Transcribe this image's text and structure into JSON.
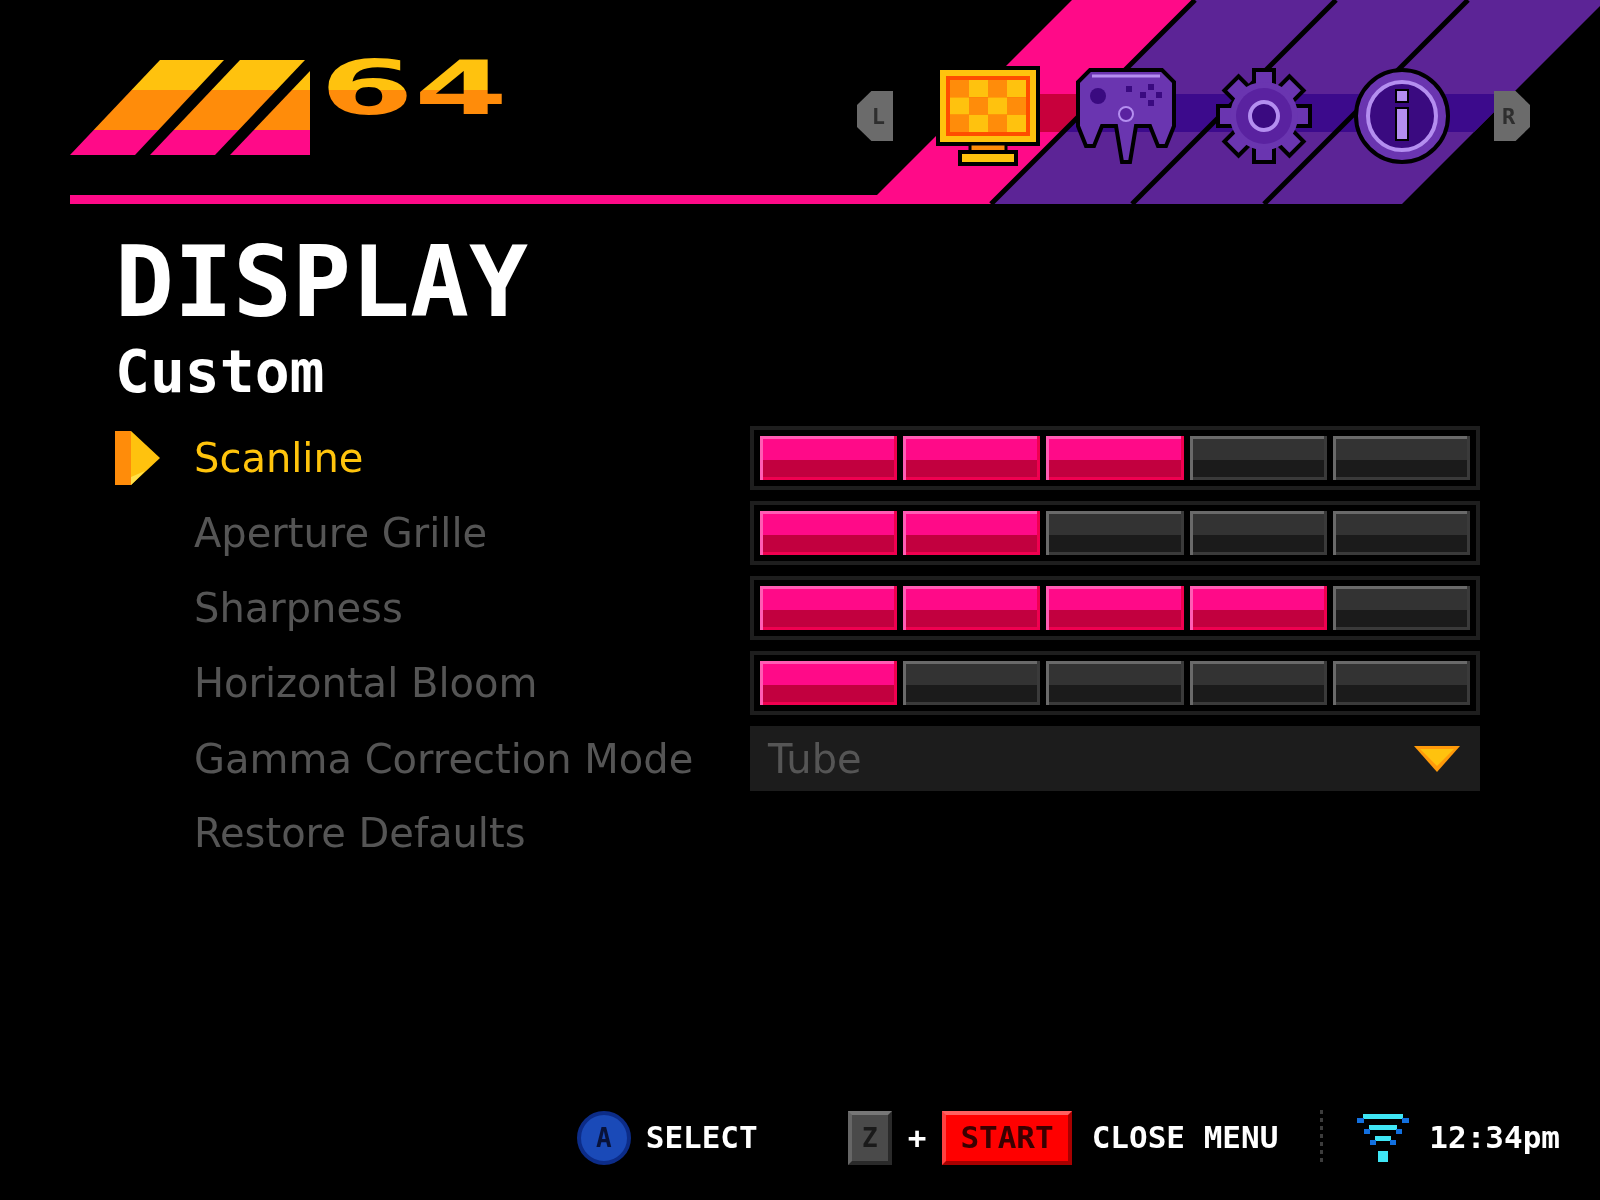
{
  "header": {
    "logo": {
      "text": "64"
    },
    "prev_key": "L",
    "next_key": "R",
    "tabs": [
      {
        "kind": "display",
        "selected": true
      },
      {
        "kind": "controller",
        "selected": false
      },
      {
        "kind": "settings",
        "selected": false
      },
      {
        "kind": "info",
        "selected": false
      }
    ]
  },
  "page": {
    "title": "DISPLAY",
    "subtitle": "Custom"
  },
  "options": [
    {
      "label": "Scanline",
      "kind": "slider",
      "selected": true,
      "level": 0.6
    },
    {
      "label": "Aperture Grille",
      "kind": "slider",
      "selected": false,
      "level": 0.4
    },
    {
      "label": "Sharpness",
      "kind": "slider",
      "selected": false,
      "level": 0.8
    },
    {
      "label": "Horizontal Bloom",
      "kind": "slider",
      "selected": false,
      "level": 0.2
    },
    {
      "label": "Gamma Correction Mode",
      "kind": "dropdown",
      "selected": false,
      "value": "Tube"
    },
    {
      "label": "Restore Defaults",
      "kind": "action",
      "selected": false
    }
  ],
  "footer": {
    "hints": [
      {
        "keys": [
          {
            "kind": "face",
            "label": "A"
          }
        ],
        "action": "SELECT"
      },
      {
        "keys": [
          {
            "kind": "trigger",
            "label": "Z"
          },
          {
            "kind": "start",
            "label": "START"
          }
        ],
        "joiner": "+",
        "action": "CLOSE MENU"
      }
    ],
    "status": {
      "time": "12:34pm"
    }
  }
}
